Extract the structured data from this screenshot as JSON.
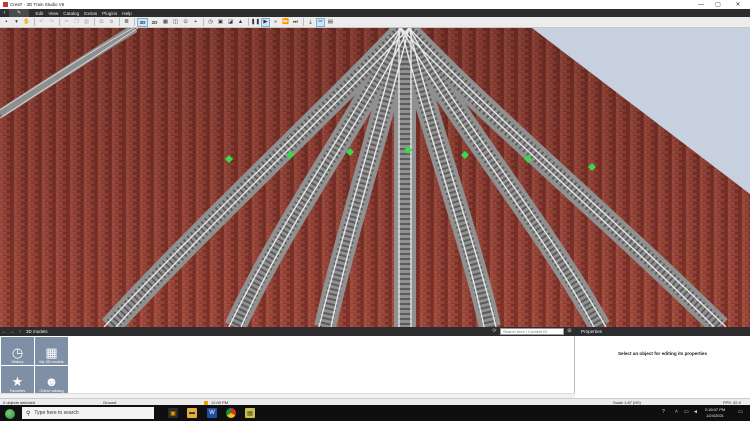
{
  "window": {
    "title": "Crest* - 3D Train Studio V6",
    "controls": {
      "minimize": "—",
      "maximize": "▢",
      "close": "✕"
    }
  },
  "menubar": {
    "items": [
      "Edit",
      "View",
      "Catalog",
      "Extras",
      "Plugins",
      "Help"
    ]
  },
  "toolbar": {
    "view_3d_label": "3D",
    "view_2d_label": "2D"
  },
  "catalog": {
    "title": "3D models",
    "search_placeholder": "Search term / Content ID",
    "tiles": [
      {
        "label": "History",
        "icon": "clock-icon"
      },
      {
        "label": "My 3D models",
        "icon": "grid-icon"
      },
      {
        "label": "Favorites",
        "icon": "star-icon"
      },
      {
        "label": "Online catalog",
        "icon": "people-icon"
      }
    ]
  },
  "properties": {
    "title": "Properties",
    "hint": "Select an object for editing its properties"
  },
  "statusbar": {
    "selection": "0 objects selected",
    "layer": "Ground",
    "time": "12:00 PM",
    "scale": "Scale 1:87 (H0)",
    "fps": "FPS: 32.9"
  },
  "taskbar": {
    "search_placeholder": "Type here to search",
    "clock_time": "2:18:07 PM",
    "clock_date": "1/24/2021"
  },
  "colors": {
    "accent": "#2d2d30",
    "tile_bg": "#7f8fa6",
    "brick": "#8e3a30",
    "sky": "#c6d0de",
    "track_marker": "#39d94a"
  }
}
